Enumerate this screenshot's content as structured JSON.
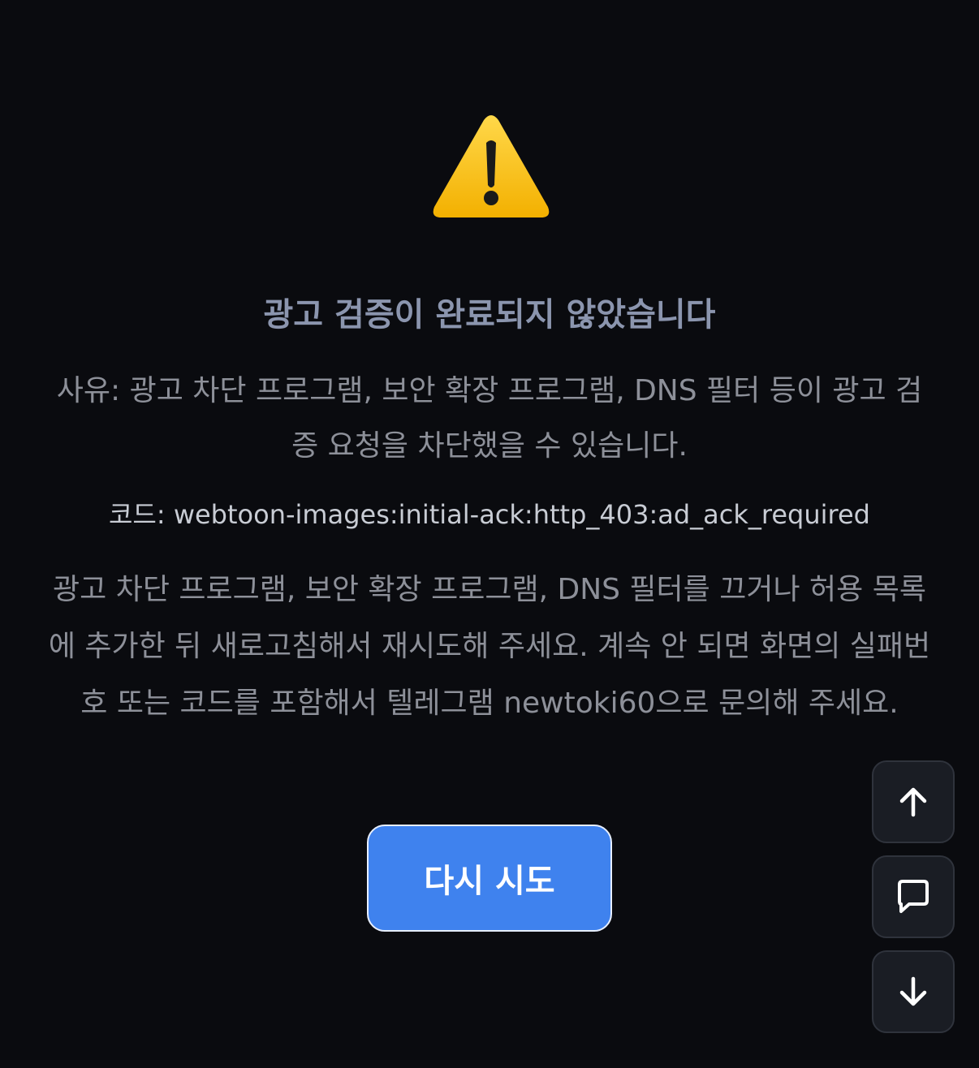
{
  "icons": {
    "warning": "warning-triangle-icon",
    "scroll_up": "arrow-up-icon",
    "chat": "chat-bubble-icon",
    "scroll_down": "arrow-down-icon"
  },
  "colors": {
    "background": "#0a0b0f",
    "title": "#8b95ae",
    "body_text": "#8d9099",
    "code_text": "#c8ccd4",
    "primary_button": "#3f82ee",
    "warning_yellow": "#f5b800"
  },
  "message": {
    "title": "광고 검증이 완료되지 않았습니다",
    "reason": "사유: 광고 차단 프로그램, 보안 확장 프로그램, DNS 필터 등이 광고 검증 요청을 차단했을 수 있습니다.",
    "code": "코드: webtoon-images:initial-ack:http_403:ad_ack_required",
    "help": "광고 차단 프로그램, 보안 확장 프로그램, DNS 필터를 끄거나 허용 목록에 추가한 뒤 새로고침해서 재시도해 주세요. 계속 안 되면 화면의 실패번호 또는 코드를 포함해서 텔레그램 newtoki60으로 문의해 주세요."
  },
  "actions": {
    "retry_label": "다시 시도"
  }
}
